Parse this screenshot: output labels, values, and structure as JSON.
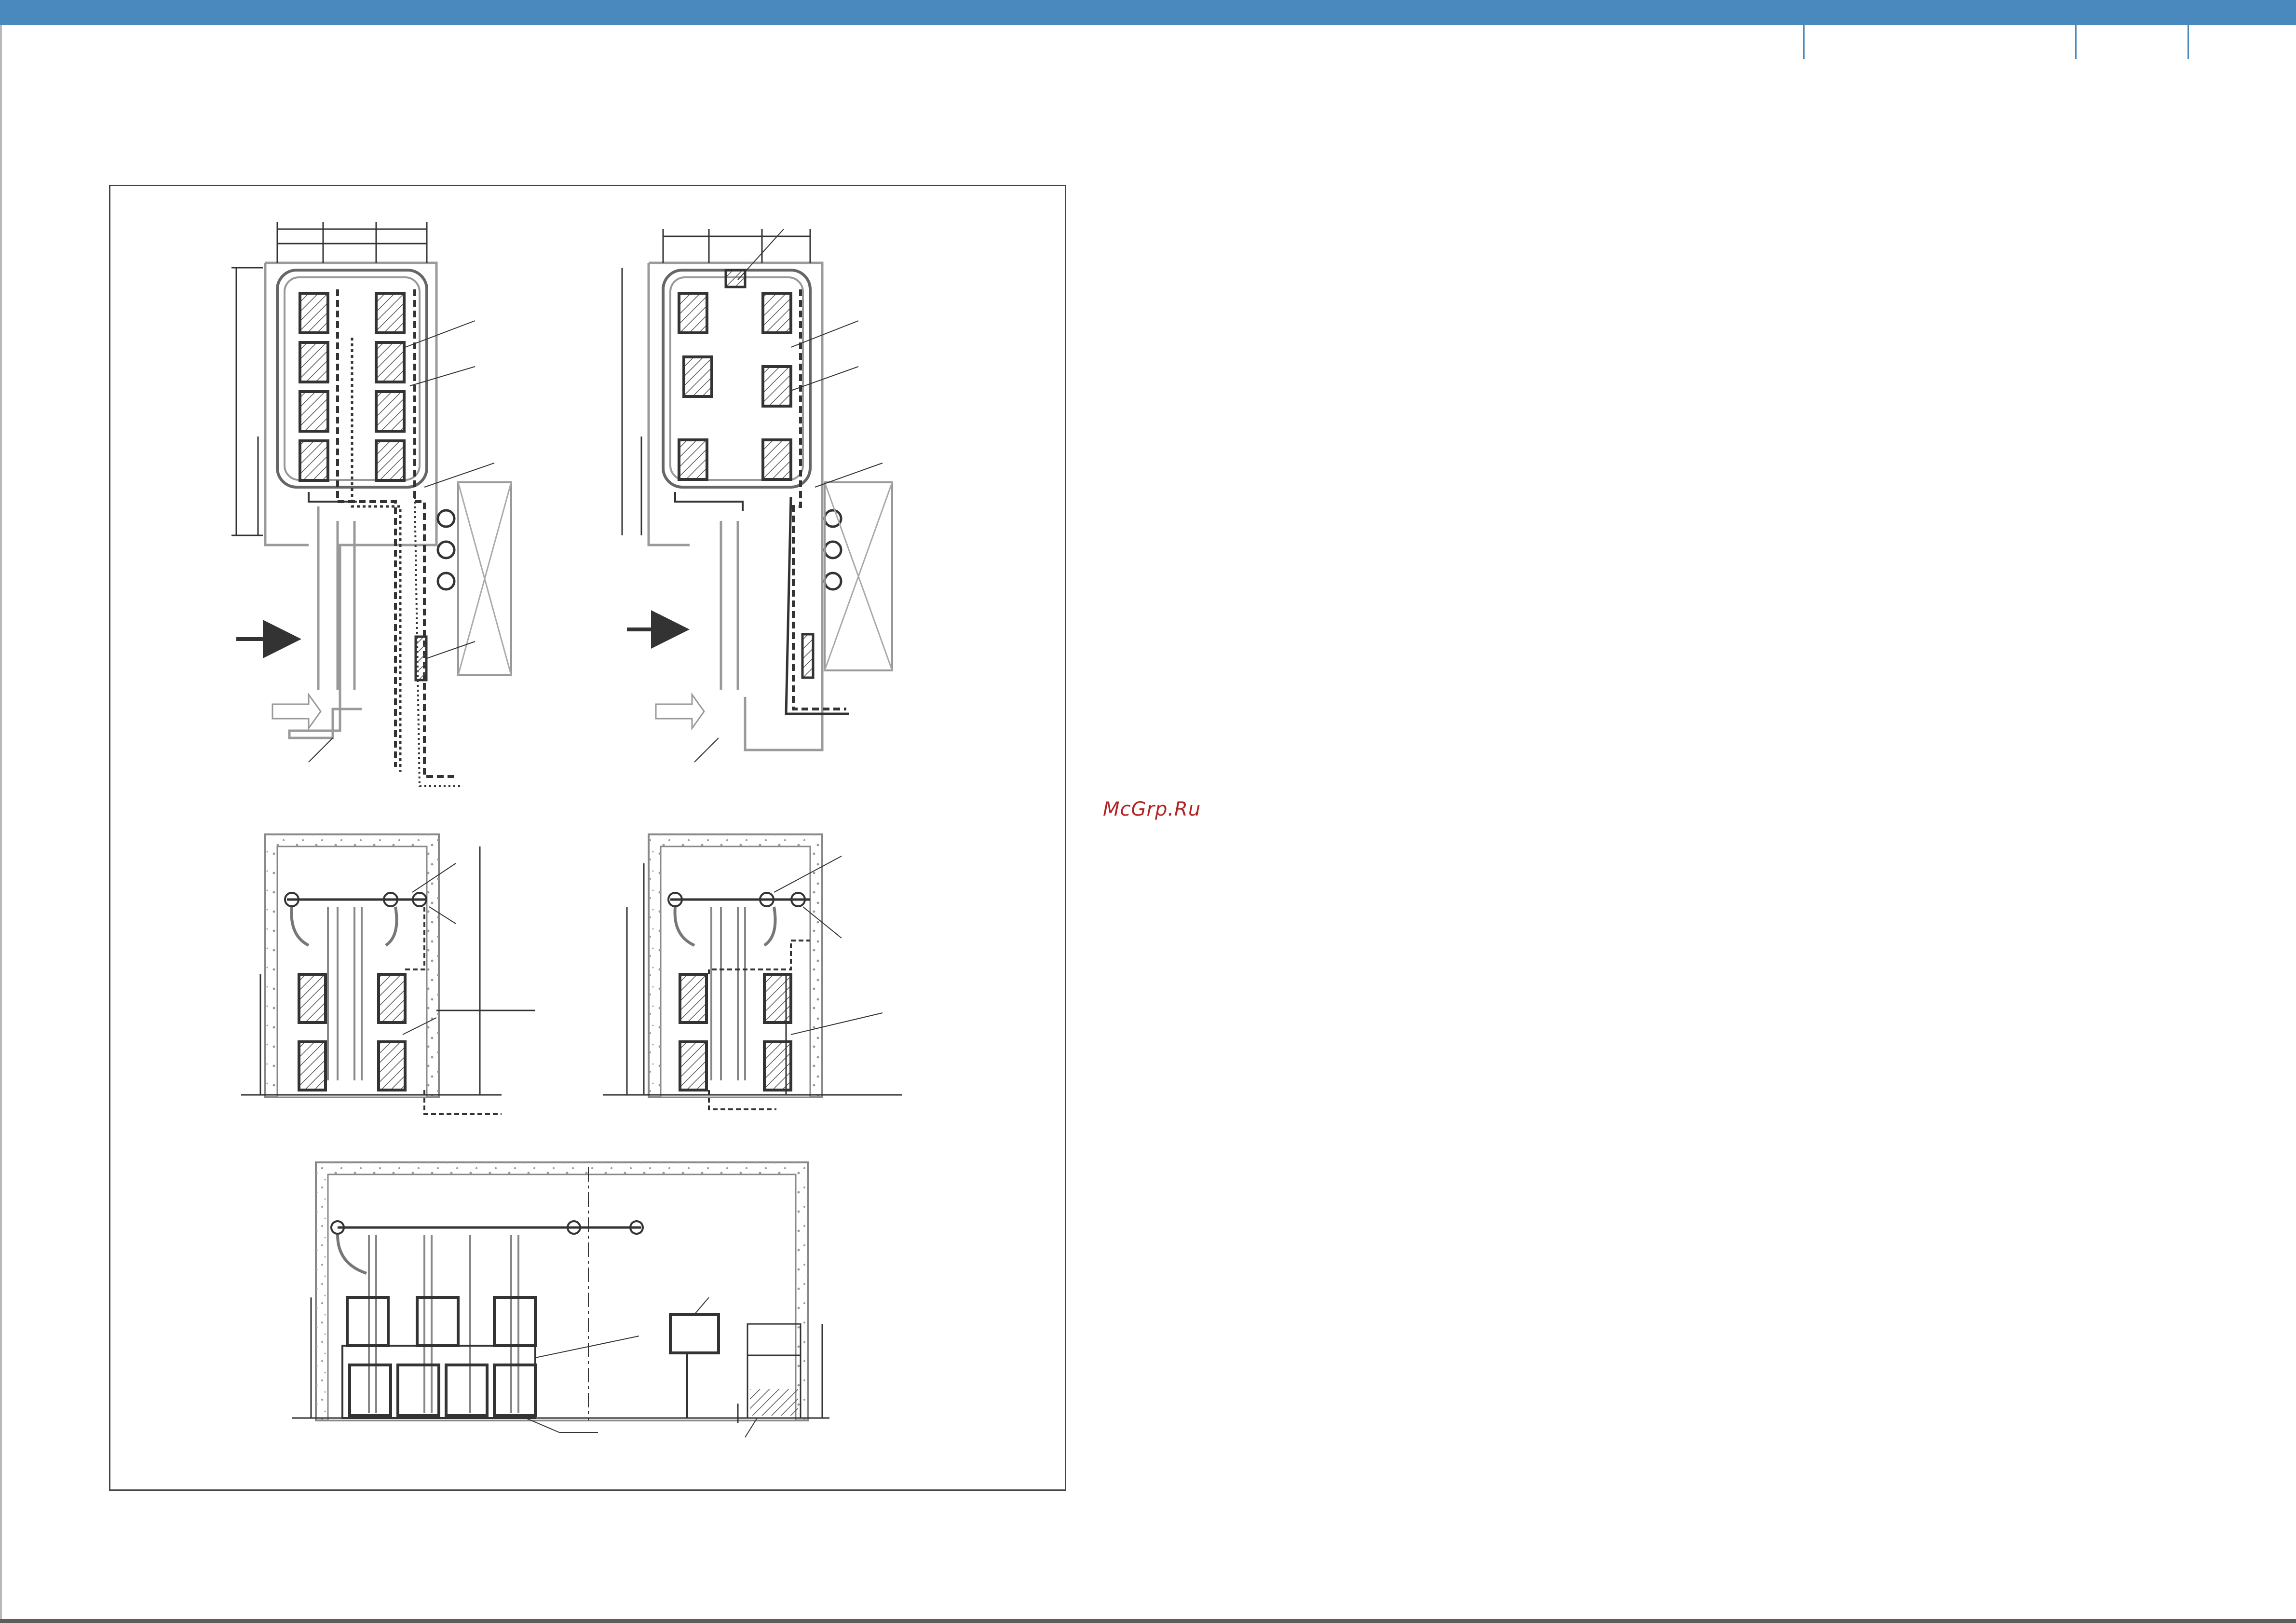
{
  "page": {
    "header_color": "#4a89bd",
    "divider_color": "#4a89bd",
    "line_color": "#333333",
    "hatch_color": "#555555",
    "wall_color": "#9a9a9a"
  },
  "watermark": {
    "text": "McGrp.Ru",
    "color": "#b22222"
  },
  "drawing": {
    "views": [
      {
        "name": "plan-view-left",
        "kind": "plan"
      },
      {
        "name": "plan-view-right",
        "kind": "plan"
      },
      {
        "name": "elevation-view-left",
        "kind": "elevation"
      },
      {
        "name": "elevation-view-right",
        "kind": "elevation"
      },
      {
        "name": "section-view-bottom",
        "kind": "section"
      }
    ]
  }
}
